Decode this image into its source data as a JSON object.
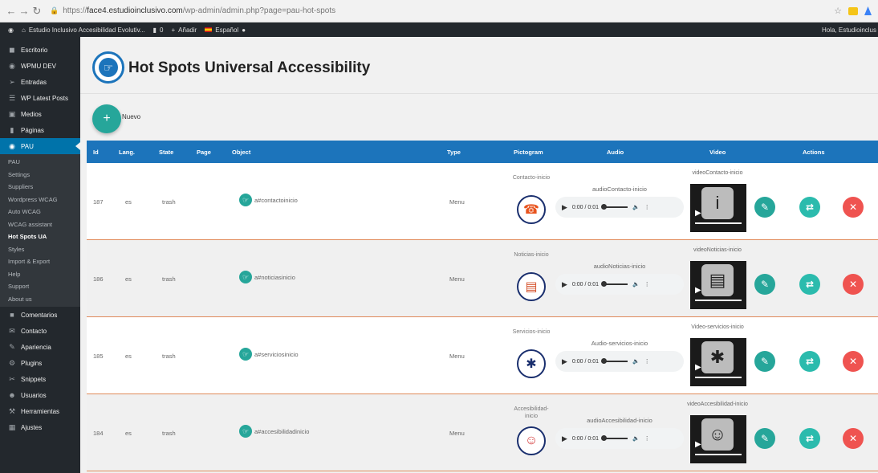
{
  "browser": {
    "url_prefix": "https://",
    "url_host": "face4.estudioinclusivo.com",
    "url_path": "/wp-admin/admin.php?page=pau-hot-spots"
  },
  "admin_bar": {
    "site": "Estudio Inclusivo Accesibilidad Evolutiv...",
    "comments": "0",
    "add": "Añadir",
    "language": "Español",
    "greeting": "Hola, Estudioinclus"
  },
  "sidebar": {
    "items_top": [
      {
        "label": "Escritorio",
        "icon": "dashboard-icon"
      },
      {
        "label": "WPMU DEV",
        "icon": "wpmu-icon"
      },
      {
        "label": "Entradas",
        "icon": "pin-icon"
      },
      {
        "label": "WP Latest Posts",
        "icon": "posts-icon"
      },
      {
        "label": "Medios",
        "icon": "media-icon"
      },
      {
        "label": "Páginas",
        "icon": "pages-icon"
      }
    ],
    "active": {
      "label": "PAU",
      "icon": "pau-icon"
    },
    "submenu": [
      "PAU",
      "Settings",
      "Suppliers",
      "Wordpress WCAG",
      "Auto WCAG",
      "WCAG assistant",
      "Hot Spots UA",
      "Styles",
      "Import & Export",
      "Help",
      "Support",
      "About us"
    ],
    "submenu_current": "Hot Spots UA",
    "items_bottom": [
      {
        "label": "Comentarios",
        "icon": "comments-icon"
      },
      {
        "label": "Contacto",
        "icon": "mail-icon"
      },
      {
        "label": "Apariencia",
        "icon": "brush-icon"
      },
      {
        "label": "Plugins",
        "icon": "plugin-icon"
      },
      {
        "label": "Snippets",
        "icon": "scissors-icon"
      },
      {
        "label": "Usuarios",
        "icon": "users-icon"
      },
      {
        "label": "Herramientas",
        "icon": "wrench-icon"
      },
      {
        "label": "Ajustes",
        "icon": "settings-icon"
      }
    ]
  },
  "page": {
    "title": "Hot Spots Universal Accessibility",
    "new_label": "Nuevo"
  },
  "table": {
    "headers": [
      "Id",
      "Lang.",
      "State",
      "Page",
      "Object",
      "Type",
      "Pictogram",
      "Audio",
      "Video",
      "Actions"
    ],
    "rows": [
      {
        "id": "187",
        "lang": "es",
        "state": "trash",
        "page": "",
        "object": "a#contactoinicio",
        "type": "Menu",
        "pictogram": "Contacto-inicio",
        "audio": "audioContacto-inicio",
        "time": "0:00 / 0:01",
        "video": "videoContacto-inicio"
      },
      {
        "id": "186",
        "lang": "es",
        "state": "trash",
        "page": "",
        "object": "a#noticiasinicio",
        "type": "Menu",
        "pictogram": "Noticias-inicio",
        "audio": "audioNoticias-inicio",
        "time": "0:00 / 0:01",
        "video": "videoNoticias-inicio"
      },
      {
        "id": "185",
        "lang": "es",
        "state": "trash",
        "page": "",
        "object": "a#serviciosinicio",
        "type": "Menu",
        "pictogram": "Servicios-inicio",
        "audio": "Audio-servicios-inicio",
        "time": "0:00 / 0:01",
        "video": "Video-servicios-inicio"
      },
      {
        "id": "184",
        "lang": "es",
        "state": "trash",
        "page": "",
        "object": "a#accesibilidadinicio",
        "type": "Menu",
        "pictogram": "Accesibilidad-inicio",
        "audio": "audioAccesibilidad-inicio",
        "time": "0:00 / 0:01",
        "video": "videoAccesibilidad-inicio"
      }
    ]
  }
}
